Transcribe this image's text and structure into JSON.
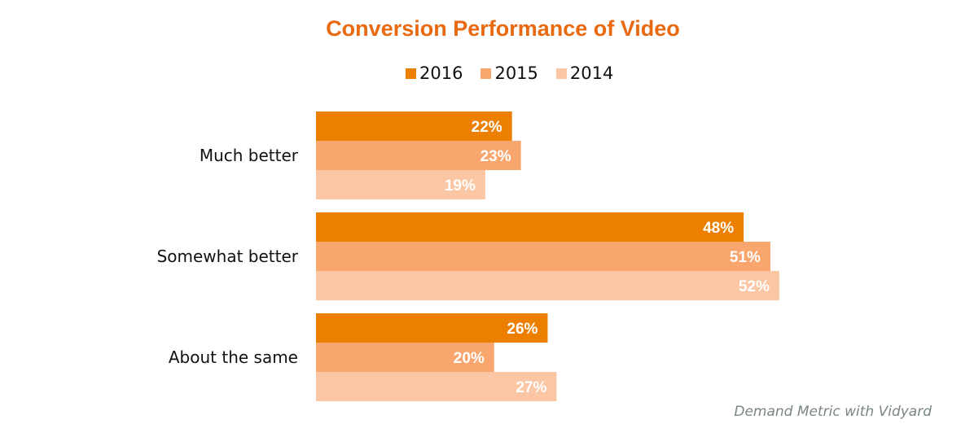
{
  "chart_data": {
    "type": "bar",
    "orientation": "horizontal",
    "title": "Conversion Performance of Video",
    "categories": [
      "Much better",
      "Somewhat better",
      "About the same"
    ],
    "series": [
      {
        "name": "2016",
        "color": "#EC7F00",
        "values": [
          22,
          48,
          26
        ],
        "labels": [
          "22%",
          "48%",
          "26%"
        ]
      },
      {
        "name": "2015",
        "color": "#F8A66D",
        "values": [
          23,
          51,
          20
        ],
        "labels": [
          "23%",
          "51%",
          "20%"
        ]
      },
      {
        "name": "2014",
        "color": "#FBC6A4",
        "values": [
          19,
          52,
          27
        ],
        "labels": [
          "19%",
          "52%",
          "27%"
        ]
      }
    ],
    "xlabel": "",
    "ylabel": "",
    "unit": "%",
    "xlim": [
      0,
      55
    ],
    "grid": false,
    "legend_position": "top-center",
    "source": "Demand Metric with Vidyard"
  },
  "title_color": "#E8690F"
}
